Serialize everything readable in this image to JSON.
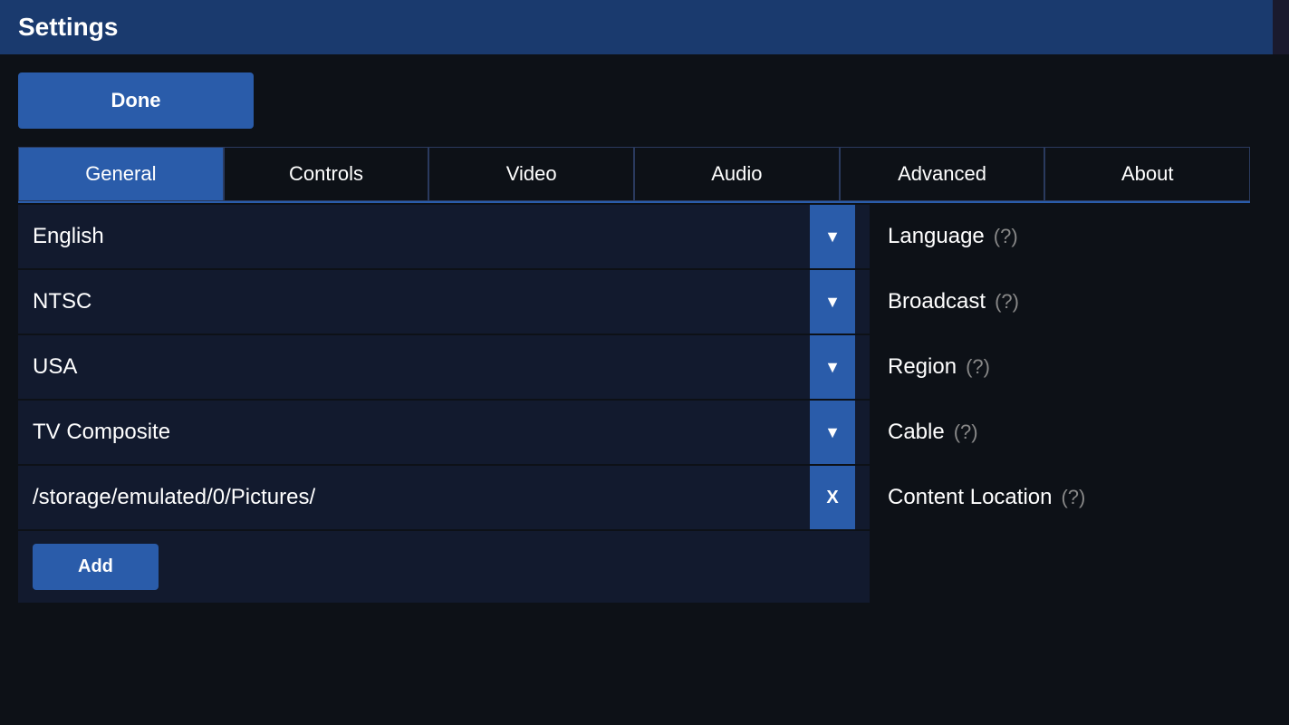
{
  "titleBar": {
    "title": "Settings"
  },
  "doneButton": {
    "label": "Done"
  },
  "tabs": [
    {
      "id": "general",
      "label": "General",
      "active": true
    },
    {
      "id": "controls",
      "label": "Controls",
      "active": false
    },
    {
      "id": "video",
      "label": "Video",
      "active": false
    },
    {
      "id": "audio",
      "label": "Audio",
      "active": false
    },
    {
      "id": "advanced",
      "label": "Advanced",
      "active": false
    },
    {
      "id": "about",
      "label": "About",
      "active": false
    }
  ],
  "settings": [
    {
      "id": "language",
      "value": "English",
      "label": "Language",
      "helpIcon": "(?)",
      "controlType": "dropdown"
    },
    {
      "id": "broadcast",
      "value": "NTSC",
      "label": "Broadcast",
      "helpIcon": "(?)",
      "controlType": "dropdown"
    },
    {
      "id": "region",
      "value": "USA",
      "label": "Region",
      "helpIcon": "(?)",
      "controlType": "dropdown"
    },
    {
      "id": "cable",
      "value": "TV Composite",
      "label": "Cable",
      "helpIcon": "(?)",
      "controlType": "dropdown"
    },
    {
      "id": "content-location",
      "value": "/storage/emulated/0/Pictures/",
      "label": "Content Location",
      "helpIcon": "(?)",
      "controlType": "x-button"
    }
  ],
  "addButton": {
    "label": "Add"
  },
  "icons": {
    "dropdownArrow": "▼",
    "xButton": "X"
  }
}
